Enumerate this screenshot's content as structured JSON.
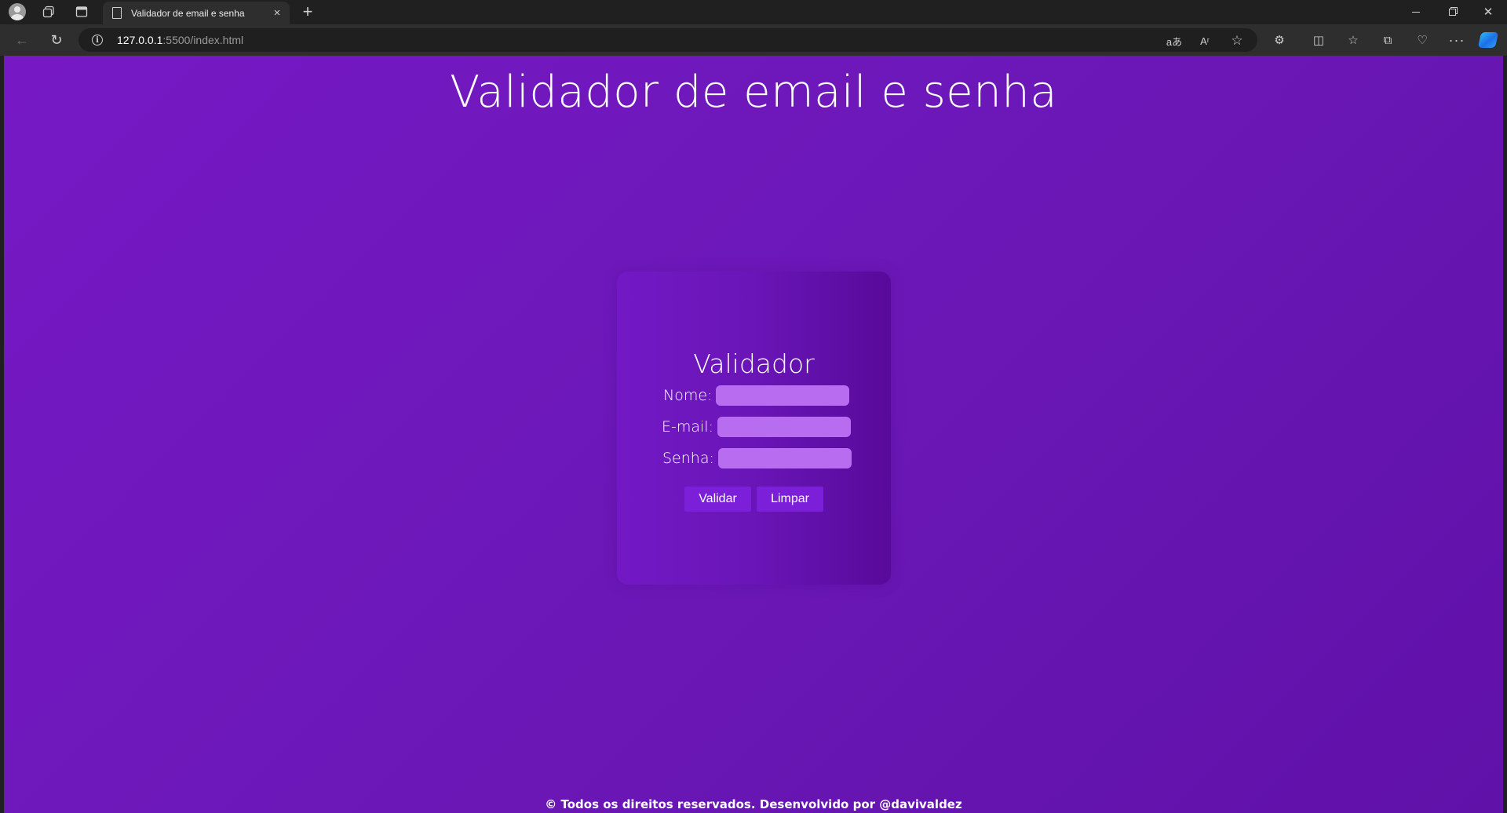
{
  "browser": {
    "tab_title": "Validador de email e senha",
    "tab_close": "×",
    "new_tab": "+",
    "url_host": "127.0.0.1",
    "url_rest": ":5500/index.html",
    "info": "i",
    "back": "←",
    "reload": "↻",
    "translate": "aあ",
    "read_aloud": "Aʳ",
    "favorite": "☆",
    "extensions": "⚙",
    "split_screen": "◫",
    "favorites": "☆",
    "collections": "⧉",
    "health": "♡",
    "more": "···",
    "close": "✕"
  },
  "page": {
    "title": "Validador de email e senha",
    "card_title": "Validador",
    "fields": {
      "nome_label": "Nome:",
      "nome_value": "",
      "email_label": "E-mail:",
      "email_value": "",
      "senha_label": "Senha:",
      "senha_value": ""
    },
    "buttons": {
      "validar": "Validar",
      "limpar": "Limpar"
    },
    "footer": "© Todos os direitos reservados. Desenvolvido por @davivaldez"
  },
  "colors": {
    "page_bg": "#7018bf",
    "card_bg": "#6915b7",
    "input_bg": "#b86df0",
    "button_bg": "#7b1fd8"
  }
}
